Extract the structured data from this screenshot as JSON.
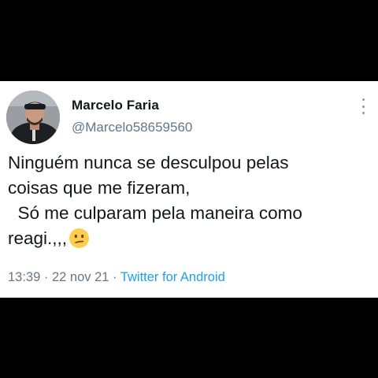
{
  "user": {
    "display_name": "Marcelo Faria",
    "handle": "@Marcelo58659560",
    "avatar_icon": "profile-photo"
  },
  "more_icon": "vertical-ellipsis-icon",
  "tweet": {
    "lines": [
      "Ninguém nunca se desculpou pelas",
      "coisas que me fizeram,",
      "  Só me culparam pela maneira como",
      "reagi.,,,"
    ],
    "emoji": "confused-face-emoji"
  },
  "meta": {
    "time": "13:39",
    "separator": " · ",
    "date": "22 nov 21",
    "source": "Twitter for Android"
  },
  "colors": {
    "background": "#000000",
    "card": "#ffffff",
    "text": "#14171a",
    "secondary": "#657786",
    "link": "#1da1f2"
  }
}
